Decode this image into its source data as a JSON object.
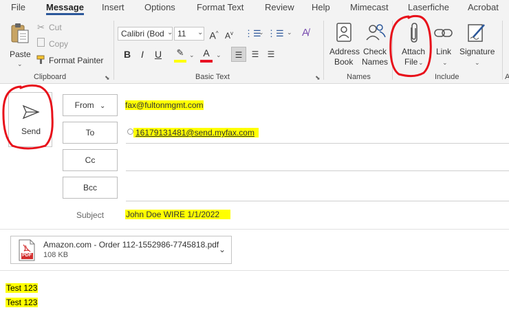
{
  "tabs": [
    "File",
    "Message",
    "Insert",
    "Options",
    "Format Text",
    "Review",
    "Help",
    "Mimecast",
    "Laserfiche",
    "Acrobat"
  ],
  "active_tab": "Message",
  "clipboard": {
    "paste": "Paste",
    "cut": "Cut",
    "copy": "Copy",
    "format_painter": "Format Painter",
    "group": "Clipboard"
  },
  "basic_text": {
    "font": "Calibri (Bod",
    "size": "11",
    "grow": "A",
    "shrink": "A",
    "bold": "B",
    "italic": "I",
    "underline": "U",
    "group": "Basic Text"
  },
  "names": {
    "address_book_1": "Address",
    "address_book_2": "Book",
    "check_names_1": "Check",
    "check_names_2": "Names",
    "group": "Names"
  },
  "include": {
    "attach_1": "Attach",
    "attach_2": "File",
    "link": "Link",
    "signature": "Signature",
    "group": "Include"
  },
  "compose": {
    "send": "Send",
    "from_button": "From",
    "from_value": "fax@fultonmgmt.com",
    "to_button": "To",
    "to_value": "16179131481@send.myfax.com",
    "cc_button": "Cc",
    "bcc_button": "Bcc",
    "subject_label": "Subject",
    "subject_value": "John Doe WIRE 1/1/2022"
  },
  "attachment": {
    "name": "Amazon.com - Order 112-1552986-7745818.pdf",
    "size": "108 KB",
    "icon_text": "PDF"
  },
  "body_lines": [
    "Test 123",
    "Test 123"
  ],
  "colors": {
    "accent": "#2b579a",
    "highlight": "#ffff00",
    "annotation": "#e8101a",
    "font_color": "#e81123",
    "pdf_red": "#d32f2f"
  }
}
